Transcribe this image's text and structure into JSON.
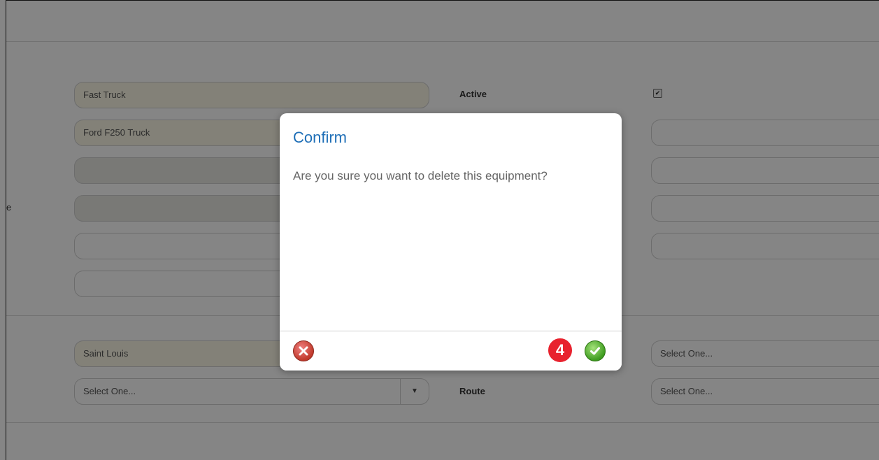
{
  "form": {
    "equipment_name": "Fast Truck",
    "description": "Ford F250 Truck",
    "field3": "",
    "field4": "",
    "field5": "",
    "field6": "",
    "active_label": "Active",
    "active_checked": true,
    "checkmark": "✔",
    "right_field1": "",
    "right_field2": "",
    "right_field3": "",
    "right_field4": "",
    "stray_char": "e",
    "location": "Saint Louis",
    "select_left": "Select One...",
    "select_caret": "▼",
    "route_label": "Route",
    "select_right_top": "Select One...",
    "select_right_route": "Select One..."
  },
  "dialog": {
    "title": "Confirm",
    "message": "Are you sure you want to delete this equipment?",
    "step_badge": "4",
    "cancel_icon": "x-circle-icon",
    "ok_icon": "check-circle-icon"
  }
}
